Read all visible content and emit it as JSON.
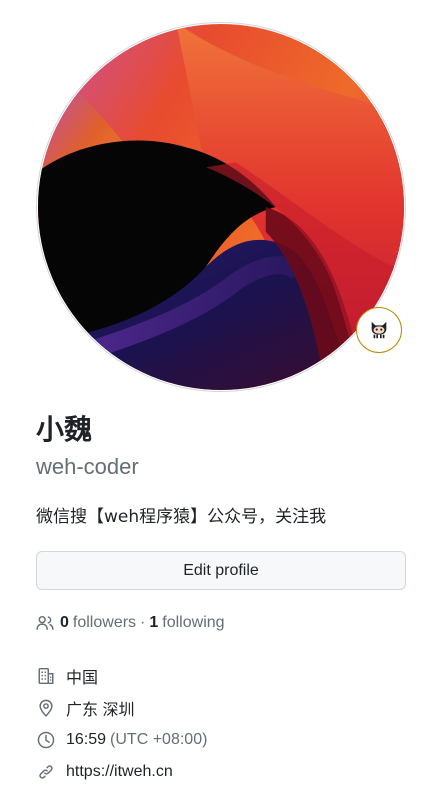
{
  "profile": {
    "name": "小魏",
    "login": "weh-coder",
    "bio": "微信搜【weh程序猿】公众号，关注我",
    "edit_button": "Edit profile"
  },
  "social": {
    "followers_count": "0",
    "followers_label": "followers",
    "separator": "·",
    "following_count": "1",
    "following_label": "following"
  },
  "details": {
    "location_country": "中国",
    "location_city": "广东 深圳",
    "local_time": "16:59",
    "timezone": "(UTC +08:00)",
    "website": "https://itweh.cn"
  },
  "icons": {
    "status": "octocat-icon",
    "followers": "people-icon",
    "organization": "building-icon",
    "location": "location-pin-icon",
    "time": "clock-icon",
    "link": "link-icon"
  },
  "colors": {
    "text": "#1f2328",
    "muted": "#656d76",
    "border": "#d0d7de",
    "button_bg": "#f6f8fa",
    "status_ring": "#bf8700"
  }
}
